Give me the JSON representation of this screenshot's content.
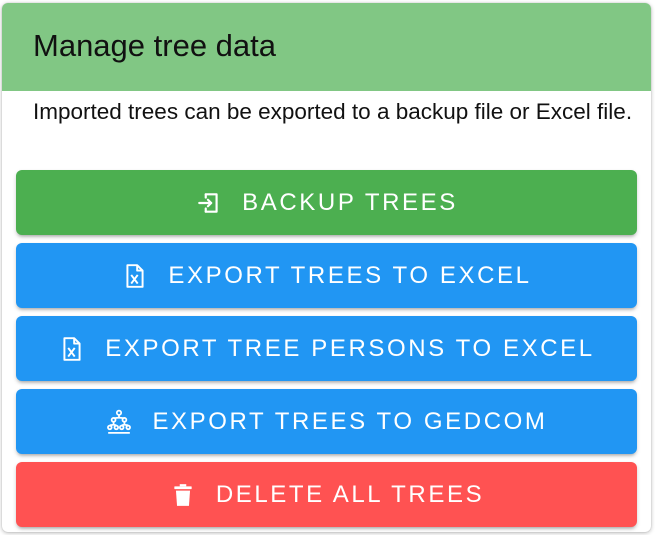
{
  "card": {
    "title": "Manage tree data",
    "description": "Imported trees can be exported to a backup file or Excel file."
  },
  "buttons": {
    "backup": {
      "label": "BACKUP TREES",
      "icon": "import-icon",
      "color": "#4caf50"
    },
    "export_trees_excel": {
      "label": "EXPORT TREES TO EXCEL",
      "icon": "excel-file-icon",
      "color": "#2196f3"
    },
    "export_persons_excel": {
      "label": "EXPORT TREE PERSONS TO EXCEL",
      "icon": "excel-file-icon",
      "color": "#2196f3"
    },
    "export_gedcom": {
      "label": "EXPORT TREES TO GEDCOM",
      "icon": "family-tree-icon",
      "color": "#2196f3"
    },
    "delete_all": {
      "label": "DELETE ALL TREES",
      "icon": "trash-icon",
      "color": "#ff5252"
    }
  },
  "colors": {
    "header": "#81c784",
    "text": "#111111"
  }
}
